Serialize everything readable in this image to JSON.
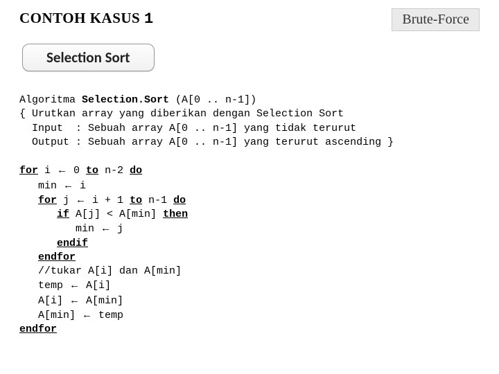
{
  "header": {
    "title_prefix": "CONTOH KASUS ",
    "title_number": "1",
    "badge": "Brute-Force"
  },
  "subheader": "Selection Sort",
  "arrow": "←",
  "code": {
    "l1_a": "Algoritma ",
    "l1_b": "Selection.Sort ",
    "l1_c": "(A[0 .. n-1])",
    "l2": "{ Urutkan array yang diberikan dengan Selection Sort",
    "l3": "  Input  : Sebuah array A[0 .. n-1] yang tidak terurut",
    "l4": "  Output : Sebuah array A[0 .. n-1] yang terurut ascending }",
    "p1_for": "for",
    "p1_mid": " i ",
    "p1_aft": " 0 ",
    "p1_to": "to",
    "p1_aft2": " n-2 ",
    "p1_do": "do",
    "p2_a": "   min ",
    "p2_b": " i",
    "p3_pre": "   ",
    "p3_for": "for",
    "p3_mid": " j ",
    "p3_aft": " i + 1 ",
    "p3_to": "to",
    "p3_aft2": " n-1 ",
    "p3_do": "do",
    "p4_pre": "      ",
    "p4_if": "if",
    "p4_mid": " A[j] < A[min] ",
    "p4_then": "then",
    "p5_a": "         min ",
    "p5_b": " j",
    "p6_pre": "      ",
    "p6_txt": "endif",
    "p7_pre": "   ",
    "p7_txt": "endfor",
    "p8": "   //tukar A[i] dan A[min]",
    "p9_a": "   temp ",
    "p9_b": " A[i]",
    "p10_a": "   A[i] ",
    "p10_b": " A[min]",
    "p11_a": "   A[min] ",
    "p11_b": " temp",
    "p12": "endfor"
  }
}
